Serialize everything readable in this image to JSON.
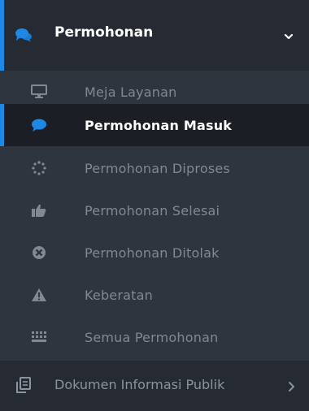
{
  "menu": {
    "title": "Permohonan",
    "icons": {
      "title": "comments-icon",
      "expand": "chevron-down-icon"
    },
    "items": [
      {
        "label": "Meja Layanan",
        "icon": "desktop-icon",
        "active": false
      },
      {
        "label": "Permohonan Masuk",
        "icon": "comment-icon",
        "active": true
      },
      {
        "label": "Permohonan Diproses",
        "icon": "spinner-icon",
        "active": false
      },
      {
        "label": "Permohonan Selesai",
        "icon": "thumbs-up-icon",
        "active": false
      },
      {
        "label": "Permohonan Ditolak",
        "icon": "times-circle-icon",
        "active": false
      },
      {
        "label": "Keberatan",
        "icon": "warning-icon",
        "active": false
      },
      {
        "label": "Semua Permohonan",
        "icon": "list-icon",
        "active": false
      }
    ]
  },
  "bottom_item": {
    "label": "Dokumen Informasi Publik",
    "icon": "documents-icon",
    "chevron": "chevron-right-icon"
  },
  "colors": {
    "accent": "#1e88e5",
    "background": "#2f353f",
    "active_background": "#1b1f25"
  }
}
